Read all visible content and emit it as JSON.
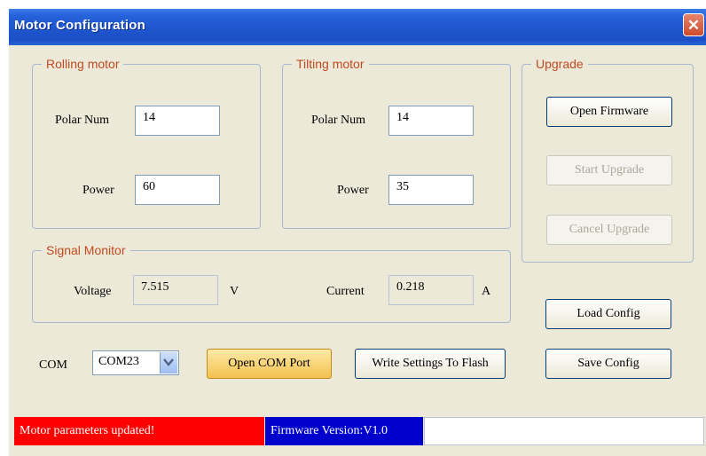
{
  "window": {
    "title": "Motor Configuration",
    "close_glyph": "✕"
  },
  "rolling": {
    "title": "Rolling motor",
    "polar_label": "Polar Num",
    "polar_value": "14",
    "power_label": "Power",
    "power_value": "60"
  },
  "tilting": {
    "title": "Tilting motor",
    "polar_label": "Polar Num",
    "polar_value": "14",
    "power_label": "Power",
    "power_value": "35"
  },
  "upgrade": {
    "title": "Upgrade",
    "open_firmware": "Open Firmware",
    "start_upgrade": "Start Upgrade",
    "cancel_upgrade": "Cancel Upgrade"
  },
  "signal": {
    "title": "Signal Monitor",
    "voltage_label": "Voltage",
    "voltage_value": "7.515",
    "voltage_unit": "V",
    "current_label": "Current",
    "current_value": "0.218",
    "current_unit": "A"
  },
  "config": {
    "load": "Load Config",
    "save": "Save Config"
  },
  "com": {
    "label": "COM",
    "selected": "COM23",
    "open_port": "Open COM Port",
    "write_flash": "Write Settings To Flash"
  },
  "status": {
    "message": "Motor parameters updated!",
    "firmware": "Firmware Version:V1.0",
    "message_color": "#FF0000",
    "firmware_color": "#0000CC"
  }
}
